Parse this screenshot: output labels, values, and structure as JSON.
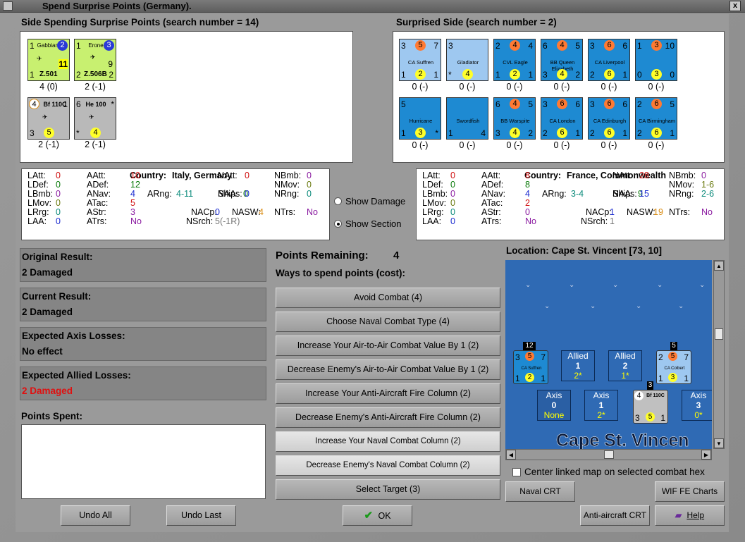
{
  "window": {
    "title": "Spend Surprise Points (Germany).",
    "close_glyph": "x"
  },
  "left_side": {
    "heading": "Side Spending Surprise Points (search number = 14)",
    "units": [
      {
        "name": "Gabbiano",
        "top_left": "1",
        "top_right": "2",
        "mid": "11",
        "bottom_left": "1",
        "bottom_right": "",
        "id": "Z.501",
        "caption": "4 (0)",
        "color": "#c8f070"
      },
      {
        "name": "Erone",
        "top_left": "1",
        "top_right": "3",
        "mid": "9",
        "bottom_left": "2",
        "bottom_right": "2",
        "id": "Z.506B",
        "caption": "2 (-1)",
        "color": "#c8f070"
      },
      {
        "name": "Bf 110C",
        "top_left": "4",
        "top_right": "1",
        "mid": "",
        "bottom_left": "3",
        "bottom_right": "5",
        "id": "",
        "caption": "2 (-1)",
        "color": "#b9b9b9"
      },
      {
        "name": "He 100",
        "top_left": "6",
        "top_right": "*",
        "mid": "",
        "bottom_left": "*",
        "bottom_right": "4",
        "id": "",
        "caption": "2 (-1)",
        "color": "#b9b9b9"
      }
    ]
  },
  "right_side": {
    "heading": "Surprised Side (search number = 2)",
    "units": [
      {
        "name": "CA Suffren",
        "top": [
          "3",
          "5",
          "7"
        ],
        "bottom": [
          "1",
          "2",
          "1"
        ],
        "caption": "0 (-)"
      },
      {
        "name": "Gladiator",
        "top": [
          "3",
          "",
          ""
        ],
        "bottom": [
          "*",
          "4",
          ""
        ],
        "caption": "0 (-)"
      },
      {
        "name": "CVL Eagle",
        "top": [
          "2",
          "4",
          "4"
        ],
        "bottom": [
          "1",
          "2",
          "1"
        ],
        "caption": "0 (-)"
      },
      {
        "name": "BB Queen Elizabeth",
        "top": [
          "6",
          "4",
          "5"
        ],
        "bottom": [
          "3",
          "4",
          "2"
        ],
        "caption": "0 (-)"
      },
      {
        "name": "CA Liverpool",
        "top": [
          "3",
          "6",
          "6"
        ],
        "bottom": [
          "2",
          "6",
          "1"
        ],
        "caption": "0 (-)"
      },
      {
        "name": "",
        "top": [
          "1",
          "3",
          "10"
        ],
        "bottom": [
          "0",
          "3",
          "0"
        ],
        "caption": "0 (-)"
      },
      {
        "name": "Hurricane",
        "top": [
          "5",
          "",
          ""
        ],
        "bottom": [
          "1",
          "3",
          "*"
        ],
        "caption": "0 (-)"
      },
      {
        "name": "Swordfish",
        "top": [
          "",
          "",
          ""
        ],
        "bottom": [
          "1",
          "",
          "4"
        ],
        "caption": "0 (-)"
      },
      {
        "name": "BB Warspite",
        "top": [
          "6",
          "4",
          "5"
        ],
        "bottom": [
          "3",
          "4",
          "2"
        ],
        "caption": "0 (-)"
      },
      {
        "name": "CA London",
        "top": [
          "3",
          "6",
          "6"
        ],
        "bottom": [
          "2",
          "6",
          "1"
        ],
        "caption": "0 (-)"
      },
      {
        "name": "CA Edinburgh",
        "top": [
          "3",
          "6",
          "6"
        ],
        "bottom": [
          "2",
          "6",
          "1"
        ],
        "caption": "0 (-)"
      },
      {
        "name": "CA Birmingham",
        "top": [
          "2",
          "6",
          "5"
        ],
        "bottom": [
          "2",
          "6",
          "1"
        ],
        "caption": "0 (-)"
      }
    ]
  },
  "left_stats": {
    "country_label": "Country:",
    "country": "Italy, Germany",
    "cells": [
      {
        "k": "LAtt:",
        "v": "0",
        "c": "v-red"
      },
      {
        "k": "AAtt:",
        "v": "10",
        "c": "v-red"
      },
      {
        "k": "NAtt:",
        "v": "0",
        "c": "v-red"
      },
      {
        "k": "NBmb:",
        "v": "0",
        "c": "v-pur"
      },
      {
        "k": "LDef:",
        "v": "0",
        "c": "v-grn"
      },
      {
        "k": "ADef:",
        "v": "12",
        "c": "v-grn"
      },
      {
        "k": "ARng:",
        "v": "4-11",
        "c": "v-tl"
      },
      {
        "k": "Ships:",
        "v": "0",
        "c": "v-grn"
      },
      {
        "k": "NMov:",
        "v": "0",
        "c": "v-olv"
      },
      {
        "k": "LBmb:",
        "v": "0",
        "c": "v-pur"
      },
      {
        "k": "ANav:",
        "v": "4",
        "c": "v-blu"
      },
      {
        "k": "NAA:",
        "v": "0",
        "c": "v-blu"
      },
      {
        "k": "NRng:",
        "v": "0",
        "c": "v-tl"
      },
      {
        "k": "LMov:",
        "v": "0",
        "c": "v-olv"
      },
      {
        "k": "ATac:",
        "v": "5",
        "c": "v-red"
      },
      {
        "k": "LRrg:",
        "v": "0",
        "c": "v-tl"
      },
      {
        "k": "AStr:",
        "v": "3",
        "c": "v-pur"
      },
      {
        "k": "NACp:",
        "v": "0",
        "c": "v-blu"
      },
      {
        "k": "NASW:",
        "v": "4",
        "c": "v-org"
      },
      {
        "k": "NTrs:",
        "v": "No",
        "c": "v-pur"
      },
      {
        "k": "LAA:",
        "v": "0",
        "c": "v-blu"
      },
      {
        "k": "ATrs:",
        "v": "No",
        "c": "v-pur"
      },
      {
        "k": "NSrch:",
        "v": "5(-1R)",
        "c": "v-gry"
      }
    ]
  },
  "right_stats": {
    "country_label": "Country:",
    "country": "France, Commonwealth",
    "cells": [
      {
        "k": "LAtt:",
        "v": "0",
        "c": "v-red"
      },
      {
        "k": "AAtt:",
        "v": "8",
        "c": "v-red"
      },
      {
        "k": "NAtt:",
        "v": "28",
        "c": "v-red"
      },
      {
        "k": "NBmb:",
        "v": "0",
        "c": "v-pur"
      },
      {
        "k": "LDef:",
        "v": "0",
        "c": "v-grn"
      },
      {
        "k": "ADef:",
        "v": "8",
        "c": "v-grn"
      },
      {
        "k": "ARng:",
        "v": "3-4",
        "c": "v-tl"
      },
      {
        "k": "Ships:",
        "v": "9",
        "c": "v-grn"
      },
      {
        "k": "NMov:",
        "v": "1-6",
        "c": "v-olv"
      },
      {
        "k": "LBmb:",
        "v": "0",
        "c": "v-pur"
      },
      {
        "k": "ANav:",
        "v": "4",
        "c": "v-blu"
      },
      {
        "k": "NAA:",
        "v": "15",
        "c": "v-blu"
      },
      {
        "k": "NRng:",
        "v": "2-6",
        "c": "v-tl"
      },
      {
        "k": "LMov:",
        "v": "0",
        "c": "v-olv"
      },
      {
        "k": "ATac:",
        "v": "2",
        "c": "v-red"
      },
      {
        "k": "LRrg:",
        "v": "0",
        "c": "v-tl"
      },
      {
        "k": "AStr:",
        "v": "0",
        "c": "v-pur"
      },
      {
        "k": "NACp:",
        "v": "1",
        "c": "v-blu"
      },
      {
        "k": "NASW:",
        "v": "19",
        "c": "v-org"
      },
      {
        "k": "NTrs:",
        "v": "No",
        "c": "v-pur"
      },
      {
        "k": "LAA:",
        "v": "0",
        "c": "v-blu"
      },
      {
        "k": "ATrs:",
        "v": "No",
        "c": "v-pur"
      },
      {
        "k": "NSrch:",
        "v": "1",
        "c": "v-gry"
      }
    ]
  },
  "options": {
    "show_damage": "Show Damage",
    "show_section": "Show Section",
    "selected": "show_section"
  },
  "results": {
    "original_label": "Original Result:",
    "original_value": "2 Damaged",
    "current_label": "Current Result:",
    "current_value": "2 Damaged",
    "axis_label": "Expected Axis Losses:",
    "axis_value": "No effect",
    "allied_label": "Expected Allied Losses:",
    "allied_value": "2 Damaged",
    "spent_label": "Points Spent:"
  },
  "spend": {
    "points_label": "Points Remaining:",
    "points_value": "4",
    "ways_label": "Ways to spend points (cost):",
    "options": [
      "Avoid Combat (4)",
      "Choose Naval Combat Type (4)",
      "Increase Your Air-to-Air Combat Value By 1 (2)",
      "Decrease Enemy's Air-to-Air Combat Value By 1 (2)",
      "Increase Your Anti-Aircraft Fire Column (2)",
      "Decrease Enemy's Anti-Aircraft Fire Column (2)",
      "Increase Your Naval Combat Column (2)",
      "Decrease Enemy's Naval Combat Column (2)",
      "Select Target (3)"
    ]
  },
  "map": {
    "location": "Location: Cape St. Vincent [73, 10]",
    "place_name": "Cape St. Vincen",
    "allied_boxes": [
      {
        "label": "Allied",
        "n": "1",
        "sub": "2*"
      },
      {
        "label": "Allied",
        "n": "2",
        "sub": "1*"
      }
    ],
    "axis_boxes": [
      {
        "label": "Axis",
        "n": "0",
        "sub": "None"
      },
      {
        "label": "Axis",
        "n": "1",
        "sub": "2*"
      },
      {
        "label": "Axis",
        "n": "3",
        "sub": "0*"
      }
    ],
    "stack1": "12",
    "stack2": "5",
    "stack3": "3",
    "counter1_name": "CA Suffren",
    "counter2_name": "CA Colbert",
    "counter3_name": "Bf 110C",
    "center_label": "Center linked map on selected combat hex"
  },
  "buttons": {
    "undo_all": "Undo All",
    "undo_last": "Undo Last",
    "ok": "OK",
    "naval_crt": "Naval CRT",
    "wif_fe": "WIF FE Charts",
    "aa_crt": "Anti-aircraft CRT",
    "help": "Help"
  },
  "colors": {
    "unit_blue": "#1e8ad2",
    "allied_red": "#e01010",
    "map_sea": "#2f6ab4"
  }
}
